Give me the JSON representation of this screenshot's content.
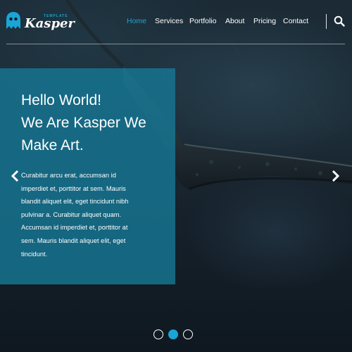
{
  "brand": {
    "name": "Kasper",
    "tagline": "TEMPLATE",
    "accent_color": "#19a6d6",
    "logo_icon": "ghost-icon"
  },
  "nav": {
    "items": [
      {
        "label": "Home",
        "active": true
      },
      {
        "label": "Services",
        "active": false
      },
      {
        "label": "Portfolio",
        "active": false
      },
      {
        "label": "About",
        "active": false
      },
      {
        "label": "Pricing",
        "active": false
      },
      {
        "label": "Contact",
        "active": false
      }
    ],
    "search_icon": "search-icon"
  },
  "slide": {
    "headline_lines": [
      "Hello World!",
      "We Are Kasper We",
      "Make Art."
    ],
    "body_lines": [
      "Curabitur arcu erat, accumsan id",
      "imperdiet et, porttitor at sem. Mauris",
      "blandit aliquet elit, eget tincidunt nibh",
      "pulvinar a. Curabitur aliquet quam.",
      "Accumsan id imperdiet et, porttitor at",
      "sem. Mauris blandit aliquet elit, eget",
      "tincidunt."
    ],
    "prev_icon": "chevron-left-icon",
    "next_icon": "chevron-right-icon"
  },
  "slider": {
    "total_slides": 3,
    "active_index": 1
  }
}
